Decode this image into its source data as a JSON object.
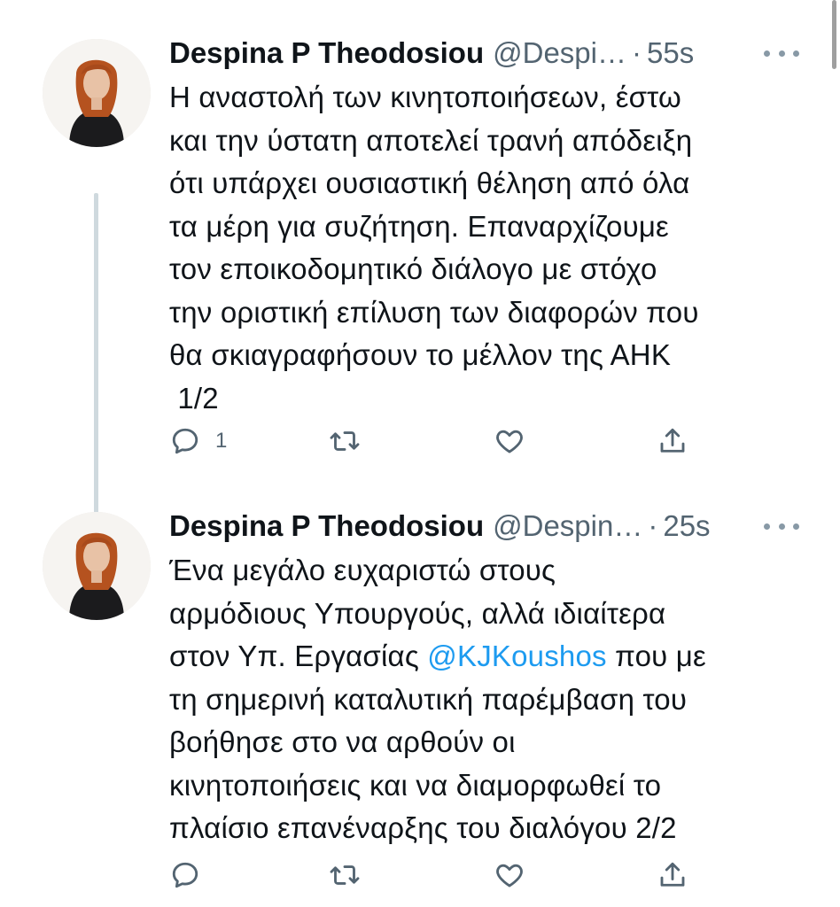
{
  "tweets": [
    {
      "display_name": "Despina P Theodosiou",
      "handle": "@Despi…",
      "separator": "·",
      "time": "55s",
      "body_lines": [
        "Η αναστολή των κινητοποιήσεων, έστω",
        "και την ύστατη αποτελεί τρανή απόδειξη",
        "ότι υπάρχει ουσιαστική θέληση από όλα",
        "τα μέρη για συζήτηση. Επαναρχίζουμε",
        "τον εποικοδομητικό διάλογο με στόχο",
        "την οριστική επίλυση των διαφορών που",
        "θα σκιαγραφήσουν το μέλλον της ΑΗΚ",
        " 1/2"
      ],
      "reply_count": "1",
      "retweet_count": "",
      "like_count": ""
    },
    {
      "display_name": "Despina P Theodosiou",
      "handle": "@Despin…",
      "separator": "·",
      "time": "25s",
      "body_lines": [
        "Ένα μεγάλο ευχαριστώ στους",
        "αρμόδιους Υπουργούς, αλλά ιδιαίτερα"
      ],
      "line3_before": "στον Υπ. Εργασίας ",
      "mention": "@KJKoushos",
      "line3_after": " που με",
      "body_lines_after": [
        "τη σημερινή καταλυτική παρέμβαση του",
        "βοήθησε στο να αρθούν οι",
        "κινητοποιήσεις και να διαμορφωθεί το",
        "πλαίσιο επανέναρξης του διαλόγου 2/2"
      ],
      "reply_count": "",
      "retweet_count": "",
      "like_count": ""
    }
  ],
  "icons": {
    "reply": "reply-icon",
    "retweet": "retweet-icon",
    "like": "heart-icon",
    "share": "share-icon",
    "more": "more-icon"
  },
  "colors": {
    "text": "#0f1419",
    "secondary": "#536471",
    "link": "#1d9bf0",
    "thread_line": "#cfd9de"
  }
}
